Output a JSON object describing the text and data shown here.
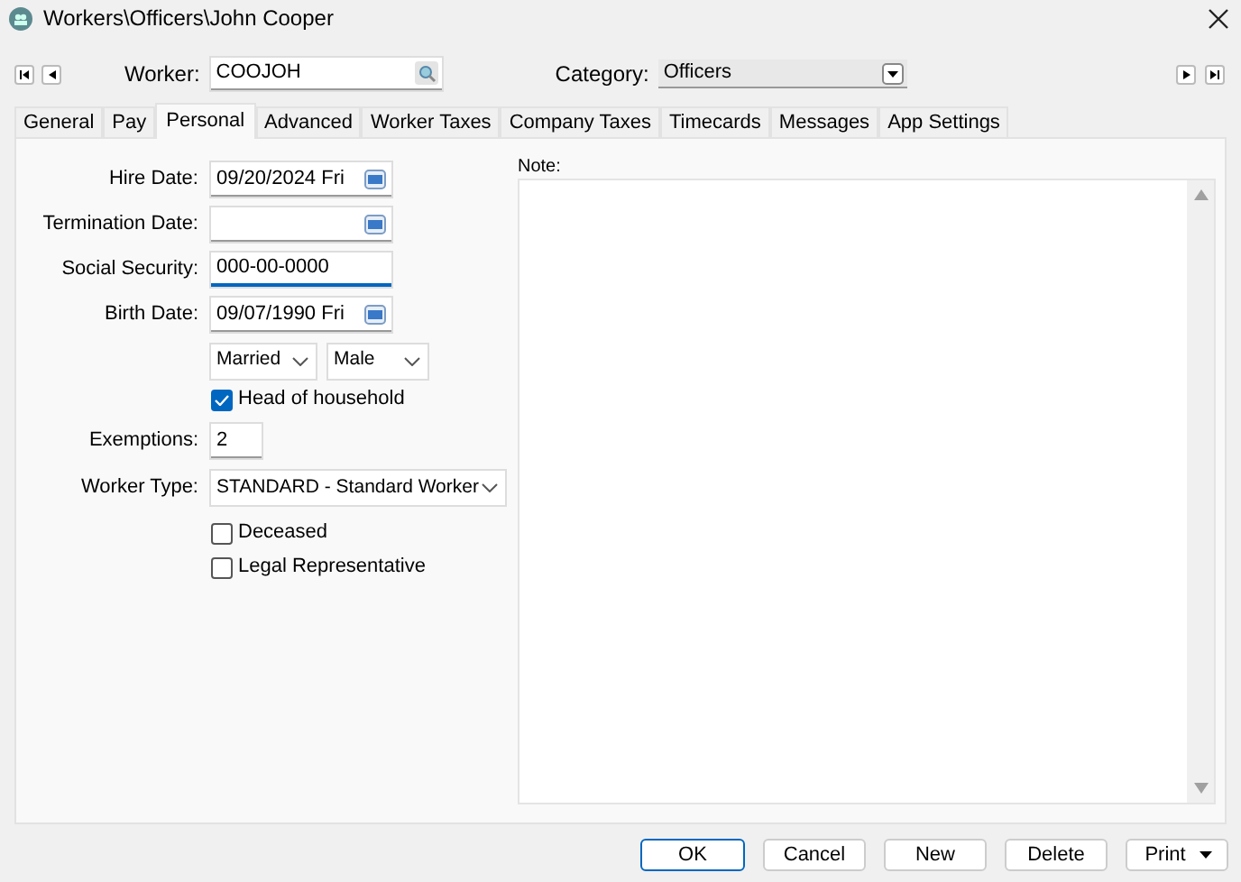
{
  "window": {
    "title": "Workers\\Officers\\John Cooper"
  },
  "worker": {
    "label": "Worker:",
    "value": "COOJOH"
  },
  "category": {
    "label": "Category:",
    "value": "Officers"
  },
  "tabs": [
    {
      "label": "General",
      "selected": false
    },
    {
      "label": "Pay",
      "selected": false
    },
    {
      "label": "Personal",
      "selected": true
    },
    {
      "label": "Advanced",
      "selected": false
    },
    {
      "label": "Worker Taxes",
      "selected": false
    },
    {
      "label": "Company Taxes",
      "selected": false
    },
    {
      "label": "Timecards",
      "selected": false
    },
    {
      "label": "Messages",
      "selected": false
    },
    {
      "label": "App Settings",
      "selected": false
    }
  ],
  "fields": [
    {
      "kind": "date",
      "label": "Hire Date:",
      "value": "09/20/2024 Fri"
    },
    {
      "kind": "date",
      "label": "Termination Date:"
    },
    {
      "kind": "text",
      "label": "Social Security:",
      "value": "000-00-0000",
      "focused": true
    },
    {
      "kind": "date",
      "label": "Birth Date:",
      "value": "09/07/1990 Fri"
    }
  ],
  "marital_status": "Married",
  "gender": "Male",
  "head_of_household": {
    "label": "Head of household",
    "checked": true
  },
  "exemptions": {
    "label": "Exemptions:",
    "value": "2"
  },
  "worker_type": {
    "label": "Worker Type:",
    "value": "STANDARD - Standard Worker"
  },
  "checkboxes": [
    {
      "label": "Deceased",
      "checked": false
    },
    {
      "label": "Legal Representative",
      "checked": false
    }
  ],
  "note": {
    "label": "Note:"
  },
  "buttons": [
    {
      "label": "OK",
      "default": true
    },
    {
      "label": "Cancel",
      "default": false
    },
    {
      "label": "New",
      "default": false
    },
    {
      "label": "Delete",
      "default": false
    },
    {
      "label": "Print",
      "default": false,
      "menu": true
    }
  ]
}
